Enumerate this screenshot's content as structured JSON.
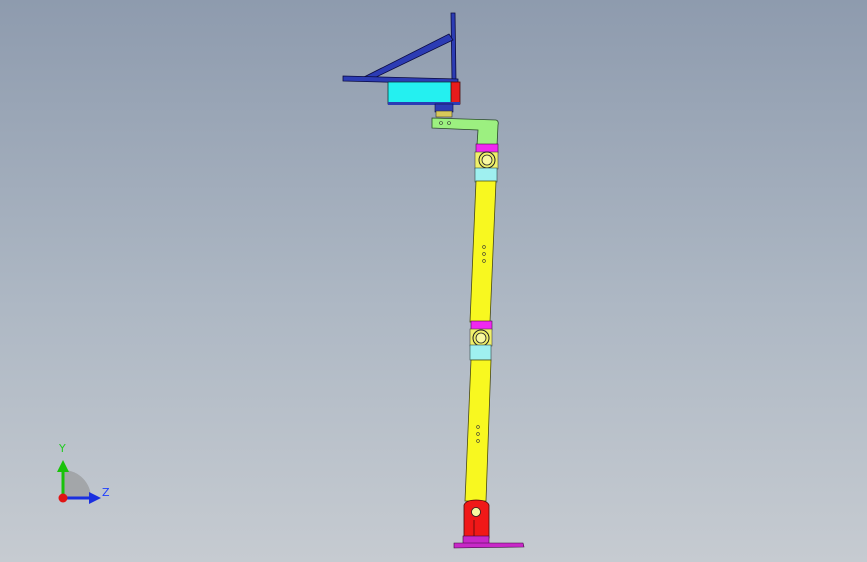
{
  "triad": {
    "y_label": "Y",
    "z_label": "Z",
    "colors": {
      "y_axis": "#19c20a",
      "z_axis": "#1a2fe0",
      "x_axis": "#e01414",
      "label_y": "#22cc22",
      "label_z": "#1f3fff",
      "quadrant": "#8c8c8c"
    }
  },
  "model_colors": {
    "frame": "#2c3cb4",
    "enclosure": "#24f0f0",
    "accent_red": "#e81c1c",
    "bracket_green": "#9cf080",
    "joint_magenta": "#f028f0",
    "joint_cyan": "#9ff0f0",
    "joint_yellow": "#f0f06a",
    "arm_yellow": "#f8f820",
    "base_red": "#f01818",
    "foot_magenta": "#c828c8"
  }
}
